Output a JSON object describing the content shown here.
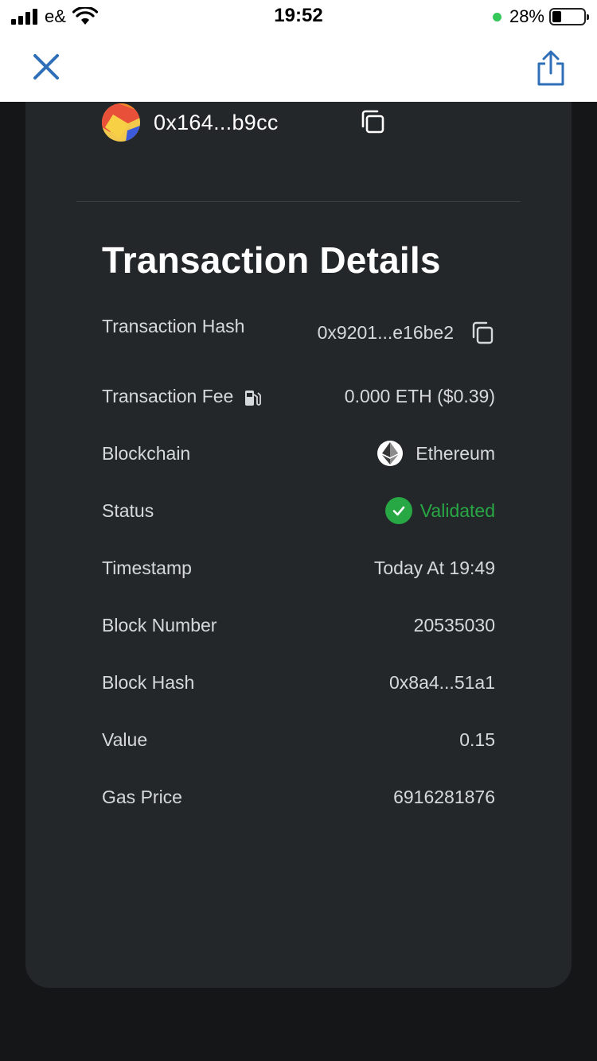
{
  "status_bar": {
    "carrier": "e&",
    "time": "19:52",
    "battery": "28%",
    "battery_level": 0.28
  },
  "nav": {
    "close_icon": "close-icon",
    "share_icon": "share-icon"
  },
  "account": {
    "address": "0x164...b9cc"
  },
  "details": {
    "title": "Transaction Details",
    "rows": [
      {
        "label": "Transaction Hash",
        "value": "0x9201...e16be2"
      },
      {
        "label": "Transaction Fee",
        "value": "0.000 ETH ($0.39)"
      },
      {
        "label": "Blockchain",
        "value": "Ethereum"
      },
      {
        "label": "Status",
        "value": "Validated"
      },
      {
        "label": "Timestamp",
        "value": "Today At 19:49"
      },
      {
        "label": "Block Number",
        "value": "20535030"
      },
      {
        "label": "Block Hash",
        "value": "0x8a4...51a1"
      },
      {
        "label": "Value",
        "value": "0.15"
      },
      {
        "label": "Gas Price",
        "value": "6916281876"
      }
    ]
  },
  "colors": {
    "accent": "#2f6fb8",
    "success": "#28a745",
    "card": "#24272a",
    "background": "#141618"
  }
}
